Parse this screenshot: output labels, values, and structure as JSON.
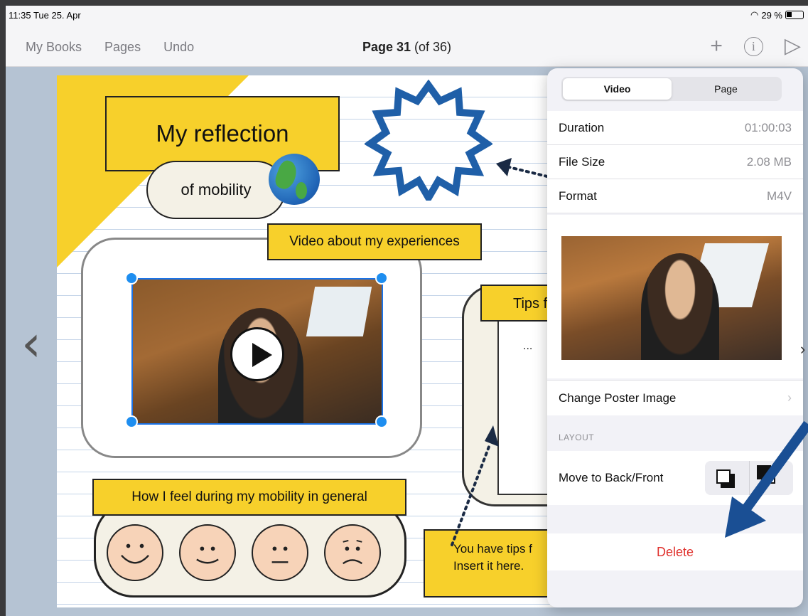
{
  "status": {
    "time": "11:35  Tue 25. Apr",
    "battery": "29 %",
    "wifi_icon": "wifi-icon"
  },
  "nav": {
    "my_books": "My Books",
    "pages": "Pages",
    "undo": "Undo",
    "page_label": "Page 31",
    "page_of": "(of 36)"
  },
  "page": {
    "title": "My reflection",
    "subtitle": "of mobility",
    "video_label": "Video about my experiences",
    "tips_label": "Tips f",
    "tips_placeholder": "...",
    "feel_label": "How I feel during my mobility in general",
    "hint_line1": "You have tips f",
    "hint_line2": "Insert it here."
  },
  "popover": {
    "tabs": [
      {
        "label": "Video",
        "active": true
      },
      {
        "label": "Page",
        "active": false
      }
    ],
    "rows": [
      {
        "label": "Duration",
        "value": "01:00:03"
      },
      {
        "label": "File Size",
        "value": "2.08 MB"
      },
      {
        "label": "Format",
        "value": "M4V"
      }
    ],
    "change_poster": "Change Poster Image",
    "layout_section": "LAYOUT",
    "move_label": "Move to Back/Front",
    "delete": "Delete"
  },
  "colors": {
    "accent_yellow": "#f7d02b",
    "delete_red": "#e0322e",
    "selection_blue": "#1e8ef0",
    "star_blue": "#1f5fa8",
    "arrow_blue": "#1a4f94"
  }
}
